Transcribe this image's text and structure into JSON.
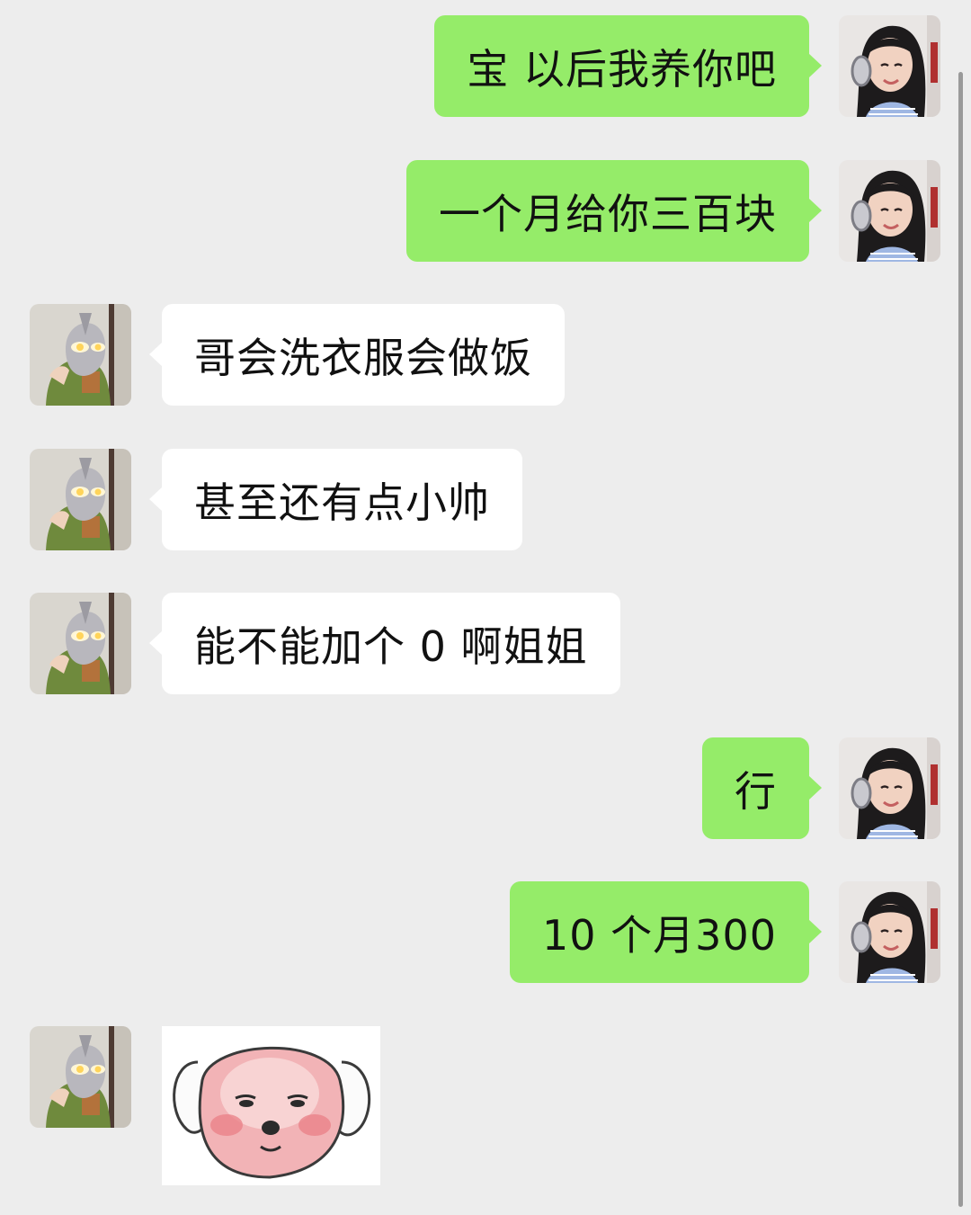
{
  "messages": [
    {
      "side": "right",
      "text": "宝 以后我养你吧"
    },
    {
      "side": "right",
      "text": "一个月给你三百块"
    },
    {
      "side": "left",
      "text": "哥会洗衣服会做饭"
    },
    {
      "side": "left",
      "text": "甚至还有点小帅"
    },
    {
      "side": "left",
      "text": "能不能加个 0 啊姐姐"
    },
    {
      "side": "right",
      "text": "行"
    },
    {
      "side": "right",
      "text": "10 个月300"
    }
  ],
  "sticker": {
    "icon": "pink-dog-sticker"
  },
  "colors": {
    "background": "#ededed",
    "outgoing_bubble": "#95ec69",
    "incoming_bubble": "#ffffff"
  },
  "avatars": {
    "self": "girl-with-headphones-avatar",
    "other": "masked-hero-avatar"
  }
}
